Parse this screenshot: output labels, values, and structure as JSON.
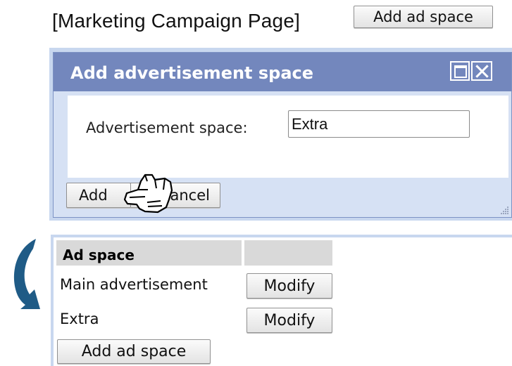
{
  "page_title": "[Marketing Campaign Page]",
  "top_button": {
    "label": "Add ad space"
  },
  "dialog": {
    "title": "Add advertisement space",
    "field_label": "Advertisement space:",
    "field_value": "Extra",
    "add_label": "Add",
    "cancel_label": "Cancel"
  },
  "table": {
    "headers": [
      "Ad space",
      ""
    ],
    "rows": [
      {
        "name": "Main advertisement",
        "action": "Modify"
      },
      {
        "name": "Extra",
        "action": "Modify"
      }
    ],
    "add_label": "Add ad space"
  },
  "icons": {
    "maximize": "maximize-icon",
    "close": "close-icon",
    "resize": "resize-grip-icon",
    "cursor": "hand-pointer-icon",
    "arrow": "curved-arrow-icon"
  },
  "colors": {
    "dialog_titlebar": "#7387bd",
    "dialog_frame": "#c8d7ef",
    "dialog_background": "#d6e1f4",
    "table_header": "#d9d9d9",
    "arrow": "#1f5b86"
  }
}
